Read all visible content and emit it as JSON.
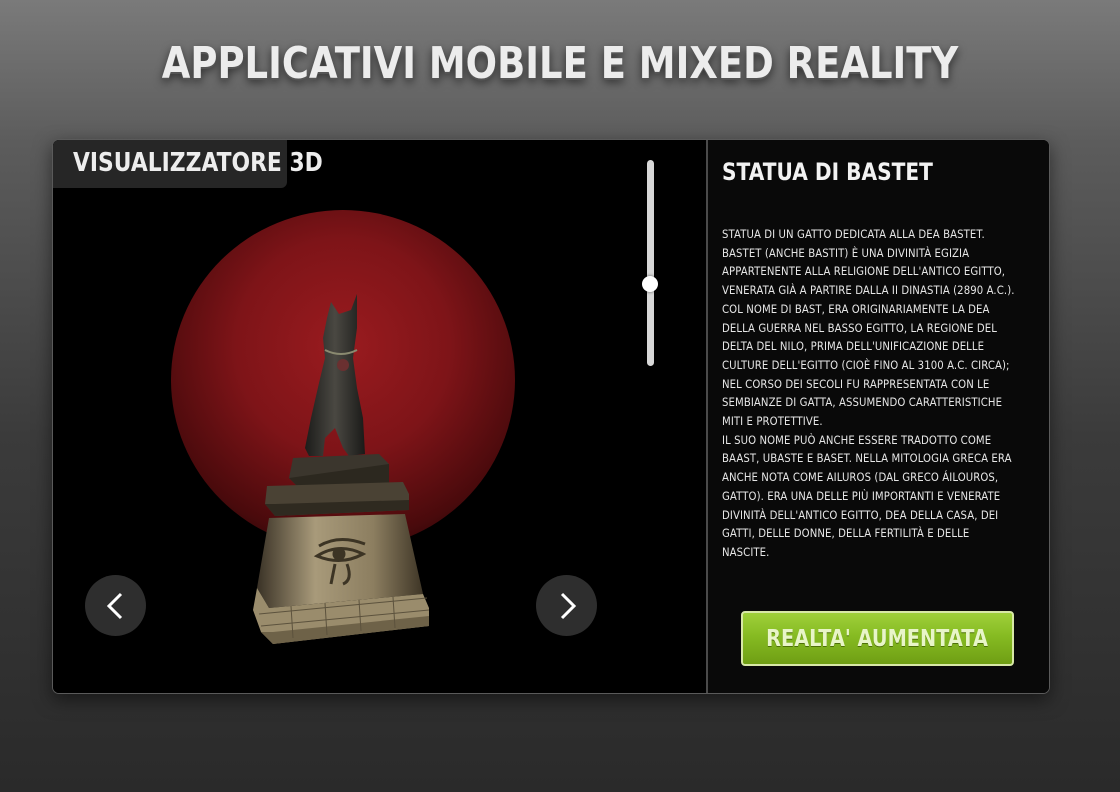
{
  "header": {
    "title": "APPLICATIVI MOBILE E MIXED REALITY"
  },
  "viewer": {
    "label": "VISUALIZZATORE 3D",
    "zoom_level": 0.6
  },
  "info": {
    "title": "STATUA DI BASTET",
    "description": "STATUA DI UN GATTO DEDICATA ALLA DEA BASTET.\nBASTET (ANCHE BASTIT) È UNA DIVINITÀ EGIZIA\nAPPARTENENTE ALLA RELIGIONE DELL'ANTICO EGITTO,\nVENERATA GIÀ A PARTIRE DALLA II DINASTIA (2890 A.C.).\nCOL NOME DI BAST, ERA ORIGINARIAMENTE LA DEA\nDELLA GUERRA NEL BASSO EGITTO, LA REGIONE DEL\nDELTA DEL NILO, PRIMA DELL'UNIFICAZIONE DELLE\nCULTURE DELL'EGITTO (CIOÈ FINO AL 3100 A.C. CIRCA);\nNEL CORSO DEI SECOLI FU RAPPRESENTATA CON LE\nSEMBIANZE DI GATTA, ASSUMENDO CARATTERISTICHE\nMITI E PROTETTIVE.\nIL SUO NOME PUÒ ANCHE ESSERE TRADOTTO COME\nBAAST, UBASTE E BASET. NELLA MITOLOGIA GRECA ERA\nANCHE NOTA COME AILUROS (DAL GRECO ÁILOUROS,\nGATTO). ERA UNA DELLE PIÙ IMPORTANTI E VENERATE\nDIVINITÀ DELL'ANTICO EGITTO, DEA DELLA CASA, DEI\nGATTI, DELLE DONNE, DELLA FERTILITÀ E DELLE\nNASCITE.",
    "ar_button_label": "REALTA' AUMENTATA"
  },
  "icons": {
    "prev": "chevron-left-icon",
    "next": "chevron-right-icon"
  },
  "colors": {
    "accent_green": "#8cc12a",
    "glow_red": "#8a1a1d"
  }
}
